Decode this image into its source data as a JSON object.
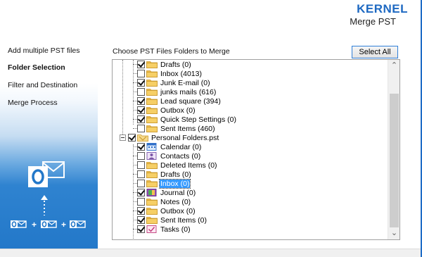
{
  "header": {
    "brand": "KERNEL",
    "product": "Merge PST"
  },
  "sidebar": {
    "steps": [
      {
        "label": "Add multiple PST files",
        "active": false
      },
      {
        "label": "Folder Selection",
        "active": true
      },
      {
        "label": "Filter and Destination",
        "active": false
      },
      {
        "label": "Merge Process",
        "active": false
      }
    ],
    "art": {
      "big_icon": "outlook-merge-icon",
      "small_icons": [
        "outlook-icon",
        "outlook-icon",
        "outlook-icon"
      ],
      "plus": "+"
    }
  },
  "main": {
    "choose_label": "Choose PST Files Folders to Merge",
    "select_all_label": "Select All"
  },
  "tree": {
    "items": [
      {
        "label": "Drafts (0)",
        "checked": true,
        "icon": "folder-icon",
        "level": 2
      },
      {
        "label": "Inbox (4013)",
        "checked": false,
        "icon": "folder-icon",
        "level": 2
      },
      {
        "label": "Junk E-mail (0)",
        "checked": true,
        "icon": "folder-icon",
        "level": 2
      },
      {
        "label": "junks mails  (616)",
        "checked": false,
        "icon": "folder-icon",
        "level": 2
      },
      {
        "label": "Lead square  (394)",
        "checked": true,
        "icon": "folder-icon",
        "level": 2
      },
      {
        "label": "Outbox (0)",
        "checked": true,
        "icon": "folder-icon",
        "level": 2
      },
      {
        "label": "Quick Step Settings (0)",
        "checked": true,
        "icon": "folder-icon",
        "level": 2
      },
      {
        "label": "Sent Items (460)",
        "checked": false,
        "icon": "folder-icon",
        "level": 2
      },
      {
        "label": "Personal Folders.pst",
        "checked": true,
        "icon": "pst-icon",
        "level": 1
      },
      {
        "label": "Calendar (0)",
        "checked": true,
        "icon": "calendar-icon",
        "level": 2
      },
      {
        "label": "Contacts (0)",
        "checked": false,
        "icon": "contacts-icon",
        "level": 2
      },
      {
        "label": "Deleted Items (0)",
        "checked": false,
        "icon": "folder-icon",
        "level": 2
      },
      {
        "label": "Drafts (0)",
        "checked": false,
        "icon": "folder-icon",
        "level": 2
      },
      {
        "label": "Inbox (0)",
        "checked": false,
        "icon": "folder-icon",
        "level": 2,
        "selected": true
      },
      {
        "label": "Journal (0)",
        "checked": true,
        "icon": "journal-icon",
        "level": 2
      },
      {
        "label": "Notes (0)",
        "checked": false,
        "icon": "folder-icon",
        "level": 2
      },
      {
        "label": "Outbox (0)",
        "checked": true,
        "icon": "folder-icon",
        "level": 2
      },
      {
        "label": "Sent Items (0)",
        "checked": true,
        "icon": "folder-icon",
        "level": 2
      },
      {
        "label": "Tasks (0)",
        "checked": true,
        "icon": "tasks-icon",
        "level": 2
      }
    ]
  },
  "colors": {
    "brand": "#1e69c2",
    "sidebar_blue": "#2378c9",
    "selection": "#3399ff"
  }
}
